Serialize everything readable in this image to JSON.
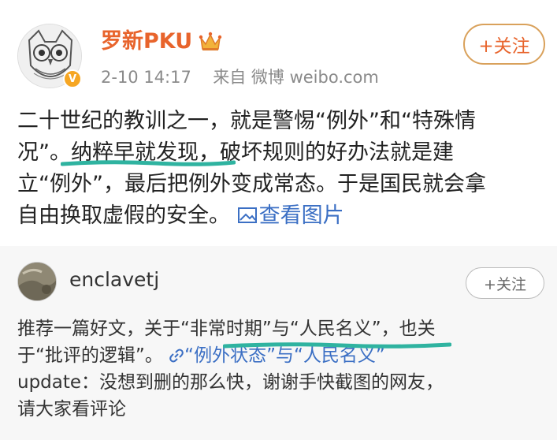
{
  "post": {
    "username": "罗新PKU",
    "timestamp": "2-10 14:17",
    "source": "来自 微博 weibo.com",
    "follow_label": "+关注",
    "verified_badge": "V",
    "crown_icon": "crown-icon",
    "text_lines": [
      "二十世纪的教训之一，就是警惕“例外”和“特殊情",
      "况”。纳粹早就发现，破坏规则的好办法就是建",
      "立“例外”，最后把例外变成常态。于是国民就会拿"
    ],
    "last_line_text": "自由换取虚假的安全。",
    "view_image_link": "查看图片",
    "highlight_color": "#2fb3a0"
  },
  "repost": {
    "username": "enclavetj",
    "follow_label": "+关注",
    "line1_prefix": "推荐一篇好文，关于",
    "line1_link": "“非常时期”与“人民名义”",
    "line1_suffix": "，也关",
    "line2_prefix": "于“批评的逻辑”。",
    "line2_link": "“例外状态”与“人民名义”",
    "line3": "update：没想到删的那么快，谢谢手快截图的网友，",
    "line4": "请大家看评论"
  }
}
